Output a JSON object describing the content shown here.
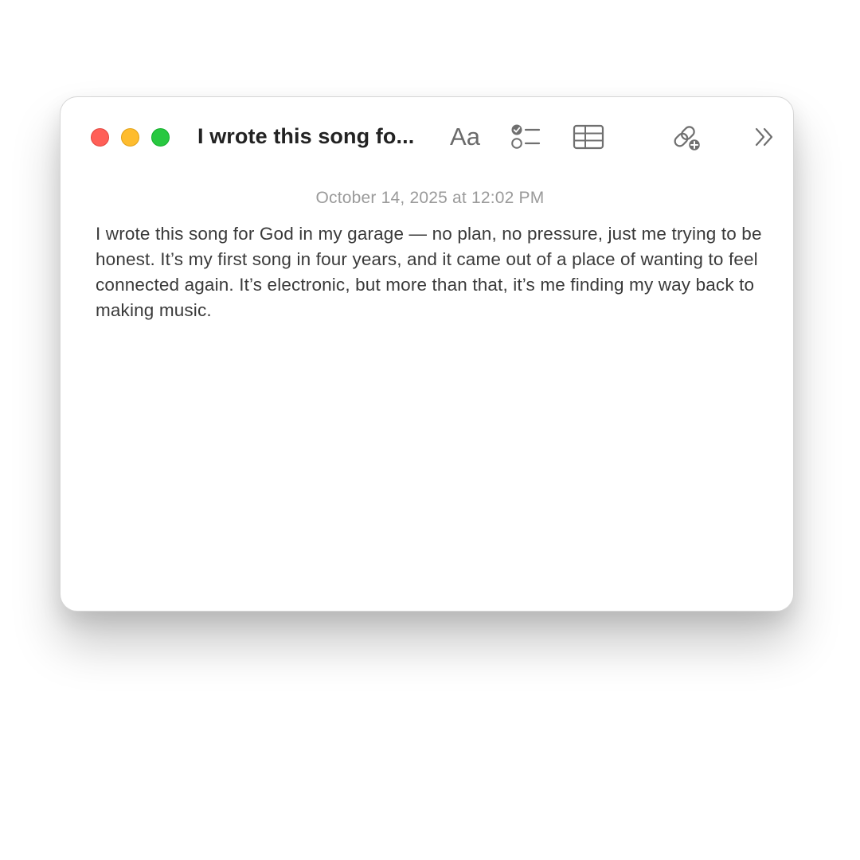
{
  "window": {
    "title": "I wrote this song fo...",
    "traffic_colors": {
      "close": "#ff5f57",
      "minimize": "#febc2e",
      "maximize": "#28c840"
    }
  },
  "toolbar": {
    "format_label": "Aa",
    "icons": [
      "format-icon",
      "checklist-icon",
      "table-icon",
      "share-link-icon",
      "more-chevrons-icon"
    ]
  },
  "note": {
    "date": "October 14, 2025 at 12:02 PM",
    "body": "I wrote this song for God in my garage — no plan, no pressure, just me trying to be honest. It’s my first song in four years, and it came out of a place of wanting to feel connected again. It’s electronic, but more than that, it’s me finding my way back to making music."
  }
}
